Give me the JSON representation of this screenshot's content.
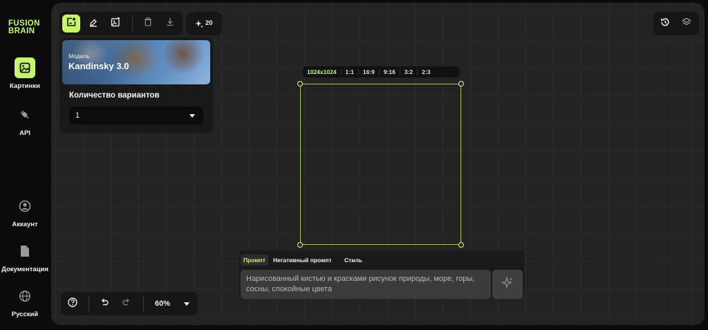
{
  "app": {
    "logo_line1": "FUSION",
    "logo_line2": "BRAIN",
    "accent_color": "#c6f46b"
  },
  "sidebar": {
    "items": [
      {
        "label": "Картинки",
        "icon": "image-icon",
        "active": true
      },
      {
        "label": "API",
        "icon": "plug-icon",
        "active": false
      },
      {
        "label": "Аккаунт",
        "icon": "user-icon",
        "active": false
      },
      {
        "label": "Документация",
        "icon": "document-icon",
        "active": false
      },
      {
        "label": "Русский",
        "icon": "globe-icon",
        "active": false
      }
    ]
  },
  "toolbar": {
    "tools": [
      "add-image-icon",
      "eraser-icon",
      "image-edit-icon",
      "trash-icon",
      "download-icon"
    ],
    "credits": "20",
    "credits_icon": "sparkle-icon"
  },
  "top_right": {
    "icons": [
      "history-icon",
      "layers-icon"
    ]
  },
  "settings": {
    "model_label": "Модель",
    "model_name": "Kandinsky 3.0",
    "variants_label": "Количество вариантов",
    "variants_value": "1"
  },
  "aspect": {
    "resolution": "1024x1024",
    "options": [
      "1:1",
      "16:9",
      "9:16",
      "3:2",
      "2:3"
    ],
    "selected": "1:1"
  },
  "prompt": {
    "tabs": [
      "Промпт",
      "Негативный промпт",
      "Стиль"
    ],
    "active_tab": "Промпт",
    "placeholder": "Нарисованный кистью и красками рисунок природы, море, горы, сосны, спокойные цвета",
    "generate_icon": "sparkle-icon"
  },
  "bottom_bar": {
    "icons": [
      "help-icon",
      "undo-icon",
      "redo-icon"
    ],
    "zoom": "60%"
  }
}
